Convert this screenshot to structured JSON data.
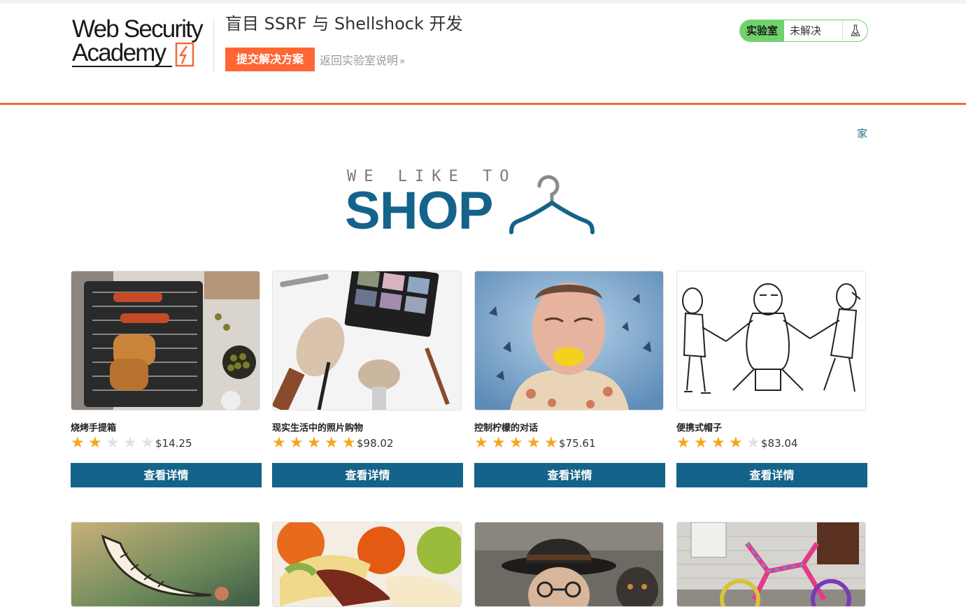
{
  "academy": {
    "logo_line1": "Web Security",
    "logo_line2": "Academy",
    "lab_title": "盲目 SSRF 与 Shellshock 开发",
    "submit_label": "提交解决方案",
    "back_label": "返回实验室说明",
    "status_label": "实验室",
    "status_value": "未解决",
    "accent_color": "#ff6633",
    "status_color": "#70d16d"
  },
  "shop": {
    "home_link": "家",
    "banner_top": "WE LIKE TO",
    "banner_main": "SHOP",
    "brand_color": "#14638a"
  },
  "products": [
    {
      "name": "烧烤手提箱",
      "price": "$14.25",
      "rating": 2,
      "button": "查看详情",
      "image": "grill-image"
    },
    {
      "name": "现实生活中的照片购物",
      "price": "$98.02",
      "rating": 5,
      "button": "查看详情",
      "image": "makeup-image"
    },
    {
      "name": "控制柠檬的对话",
      "price": "$75.61",
      "rating": 5,
      "button": "查看详情",
      "image": "lemon-face-image"
    },
    {
      "name": "便携式帽子",
      "price": "$83.04",
      "rating": 4,
      "button": "查看详情",
      "image": "sketch-image"
    }
  ],
  "products_row2": [
    {
      "image": "smile-image"
    },
    {
      "image": "fruit-image"
    },
    {
      "image": "hat-man-image"
    },
    {
      "image": "bicycle-image"
    }
  ]
}
